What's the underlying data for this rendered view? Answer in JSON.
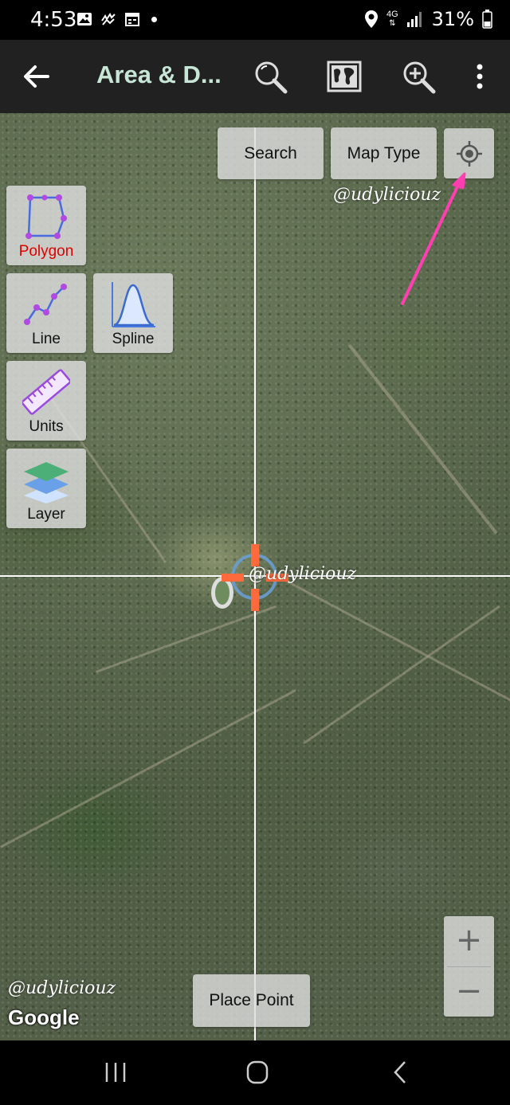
{
  "status_bar": {
    "time": "4:53",
    "network": "4G",
    "battery": "31%"
  },
  "app_bar": {
    "title": "Area & D...",
    "icons": [
      "back-arrow-icon",
      "search-icon",
      "map-type-icon",
      "zoom-in-icon",
      "more-vert-icon"
    ]
  },
  "map": {
    "search_label": "Search",
    "map_type_label": "Map Type",
    "tools": [
      {
        "label": "Polygon",
        "icon": "polygon-icon",
        "active": true
      },
      {
        "label": "Line",
        "icon": "line-icon"
      },
      {
        "label": "Spline",
        "icon": "spline-icon"
      },
      {
        "label": "Units",
        "icon": "ruler-icon"
      },
      {
        "label": "Layer",
        "icon": "layers-icon"
      }
    ],
    "place_point_label": "Place Point",
    "zoom_in": "+",
    "zoom_out": "−",
    "google_logo": "Google",
    "watermark": "@udyliciouz"
  },
  "colors": {
    "app_bar_bg": "#212121",
    "title": "#c8e6d6",
    "polygon_active": "#e00000",
    "arrow": "#ff3fb0",
    "target": "#ff6a3d",
    "location_ring": "#6aa0d8"
  }
}
